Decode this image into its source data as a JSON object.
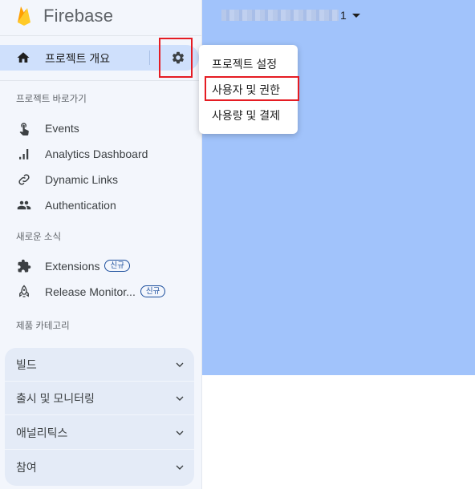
{
  "brand": {
    "name": "Firebase"
  },
  "overview": {
    "label": "프로젝트 개요"
  },
  "project_selector": {
    "suffix": "1"
  },
  "sections": {
    "shortcuts_title": "프로젝트 바로가기",
    "news_title": "새로운 소식",
    "categories_title": "제품 카테고리"
  },
  "shortcuts": [
    {
      "label": "Events",
      "icon": "touch-icon"
    },
    {
      "label": "Analytics Dashboard",
      "icon": "bar-chart-icon"
    },
    {
      "label": "Dynamic Links",
      "icon": "link-icon"
    },
    {
      "label": "Authentication",
      "icon": "people-icon"
    }
  ],
  "news": [
    {
      "label": "Extensions",
      "badge": "신규",
      "icon": "puzzle-icon"
    },
    {
      "label": "Release Monitor...",
      "badge": "신규",
      "icon": "rocket-icon"
    }
  ],
  "categories": [
    {
      "label": "빌드"
    },
    {
      "label": "출시 및 모니터링"
    },
    {
      "label": "애널리틱스"
    },
    {
      "label": "참여"
    }
  ],
  "menu": {
    "items": [
      {
        "label": "프로젝트 설정"
      },
      {
        "label": "사용자 및 권한"
      },
      {
        "label": "사용량 및 결제"
      }
    ]
  },
  "colors": {
    "highlight_red": "#e51c23",
    "header_blue": "#a1c3fb",
    "overview_bg": "#cfe0fc",
    "sidebar_bg": "#f3f6fc"
  }
}
